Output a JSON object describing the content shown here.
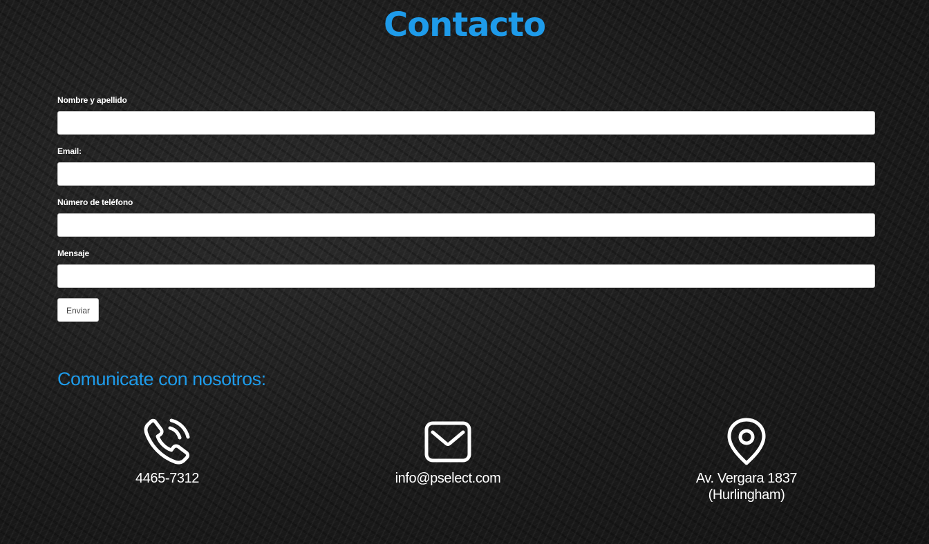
{
  "page": {
    "title": "Contacto"
  },
  "form": {
    "fields": [
      {
        "label": "Nombre y apellido",
        "value": "",
        "placeholder": ""
      },
      {
        "label": "Email:",
        "value": "",
        "placeholder": ""
      },
      {
        "label": "Número de teléfono",
        "value": "",
        "placeholder": ""
      },
      {
        "label": "Mensaje",
        "value": "",
        "placeholder": ""
      }
    ],
    "submit_label": "Enviar"
  },
  "contact": {
    "heading": "Comunicate con nosotros:",
    "phone": {
      "icon": "phone-icon",
      "text": "4465-7312"
    },
    "email": {
      "icon": "envelope-icon",
      "text": "info@pselect.com"
    },
    "address": {
      "icon": "map-pin-icon",
      "line1": "Av. Vergara 1837",
      "line2": "(Hurlingham)"
    }
  },
  "colors": {
    "accent": "#1e9bea",
    "background": "#1c1c1c",
    "text": "#ffffff"
  }
}
